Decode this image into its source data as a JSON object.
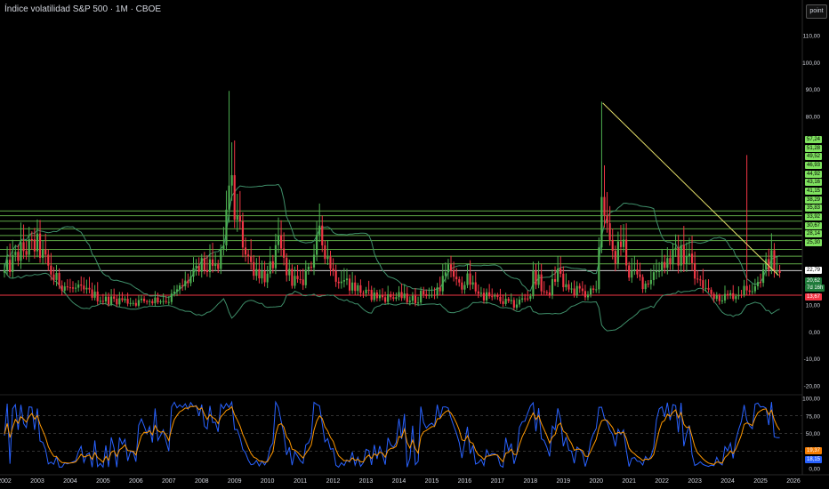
{
  "header": {
    "title": "Índice volatilidad S&P 500 · 1M · CBOE",
    "mode_button": "point"
  },
  "colors": {
    "background": "#000000",
    "up": "#4caf50",
    "down": "#f23645",
    "hline": "#7fe25f",
    "trendline": "#e6e06a",
    "band": "#3f8f6a",
    "support": "#f23645",
    "rsi_fast": "#2962ff",
    "rsi_slow": "#ff9800",
    "text": "#d1d4dc"
  },
  "price_scale": {
    "ticks": [
      "110,00",
      "100,00",
      "90,00",
      "80,00",
      "10,00",
      "0,00",
      "-10,00",
      "-20,00"
    ],
    "tick_values": [
      110,
      100,
      90,
      80,
      10,
      0,
      -10,
      -20
    ]
  },
  "levels": {
    "green_labels": [
      "57,24",
      "51,28",
      "49,52",
      "46,93",
      "44,92",
      "43,16",
      "41,15",
      "38,29",
      "35,83",
      "33,92",
      "30,67",
      "28,14",
      "25,30"
    ],
    "green_values": [
      57.24,
      51.28,
      49.52,
      46.93,
      44.92,
      43.16,
      41.15,
      38.29,
      35.83,
      33.92,
      30.67,
      28.14,
      25.3
    ],
    "line_values": [
      44.92,
      43.16,
      41.15,
      38.29,
      35.83,
      33.92,
      30.67,
      28.14,
      25.3
    ],
    "white_label": "22,79",
    "white_value": 22.79,
    "current_label": "20,62",
    "current_value": 20.62,
    "countdown": "7d 16h",
    "red_label": "13,67",
    "red_value": 13.67
  },
  "rsi_scale": {
    "ticks": [
      "100,00",
      "75,00",
      "50,00",
      "25,00",
      "0,00"
    ],
    "tick_values": [
      100,
      75,
      50,
      25,
      0
    ],
    "label_orange": "19,37",
    "value_orange": 19.37,
    "label_blue": "18,15",
    "value_blue": 18.15
  },
  "time_axis": [
    "2002",
    "2003",
    "2004",
    "2005",
    "2006",
    "2007",
    "2008",
    "2009",
    "2010",
    "2011",
    "2012",
    "2013",
    "2014",
    "2015",
    "2016",
    "2017",
    "2018",
    "2019",
    "2020",
    "2021",
    "2022",
    "2023",
    "2024",
    "2025",
    "2026"
  ],
  "chart_data": {
    "type": "candlestick",
    "title": "Índice volatilidad S&P 500 · 1M · CBOE",
    "interval": "1M",
    "x_range": [
      2002,
      2026
    ],
    "ylim": [
      -22,
      115
    ],
    "series": [
      {
        "name": "VIX",
        "x": [
          2002.0,
          2002.5,
          2003.0,
          2003.5,
          2004.0,
          2004.5,
          2005.0,
          2005.5,
          2006.0,
          2006.5,
          2007.0,
          2007.5,
          2008.0,
          2008.5,
          2008.75,
          2008.83,
          2009.0,
          2009.2,
          2009.5,
          2010.0,
          2010.35,
          2010.6,
          2011.0,
          2011.6,
          2011.8,
          2012.0,
          2012.5,
          2013.0,
          2013.5,
          2014.0,
          2014.5,
          2014.8,
          2015.0,
          2015.6,
          2015.8,
          2016.0,
          2016.5,
          2017.0,
          2017.5,
          2018.0,
          2018.1,
          2018.5,
          2018.9,
          2019.0,
          2019.5,
          2020.0,
          2020.2,
          2020.3,
          2020.5,
          2020.8,
          2021.0,
          2021.5,
          2022.0,
          2022.5,
          2022.8,
          2023.0,
          2023.5,
          2024.0,
          2024.6,
          2024.7,
          2025.0,
          2025.3,
          2025.5
        ],
        "values": [
          22,
          30,
          32,
          20,
          16,
          15,
          12,
          12,
          11,
          12,
          12,
          18,
          24,
          23,
          40,
          60,
          44,
          36,
          25,
          20,
          32,
          22,
          17,
          35,
          30,
          22,
          18,
          14,
          13,
          13,
          12,
          15,
          13,
          24,
          16,
          20,
          14,
          12,
          10,
          14,
          22,
          13,
          24,
          16,
          15,
          14,
          60,
          38,
          27,
          34,
          22,
          18,
          26,
          28,
          30,
          20,
          14,
          13,
          16,
          17,
          20,
          28,
          21
        ]
      }
    ],
    "annotations": {
      "horizontal_levels": [
        44.92,
        43.16,
        41.15,
        38.29,
        35.83,
        33.92,
        30.67,
        28.14,
        25.3,
        22.79,
        13.67
      ],
      "trendline": {
        "from": [
          2020.2,
          85
        ],
        "to": [
          2025.55,
          21
        ]
      },
      "extreme_highs": [
        {
          "x": 2008.83,
          "y": 89.5
        },
        {
          "x": 2020.2,
          "y": 85.5
        },
        {
          "x": 2024.6,
          "y": 65.7
        }
      ]
    },
    "indicator": {
      "name": "RSI",
      "ylim": [
        0,
        100
      ],
      "guides": [
        75,
        50,
        25
      ]
    }
  }
}
